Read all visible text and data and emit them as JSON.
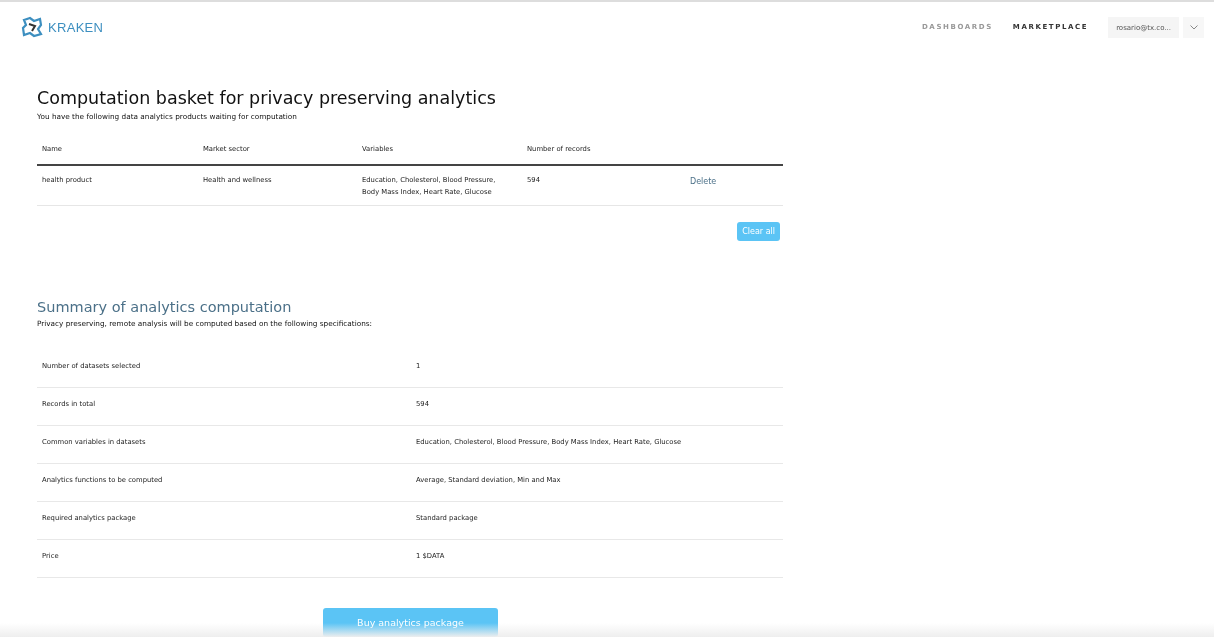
{
  "header": {
    "logo": "KRAKEN",
    "nav": [
      {
        "label": "DASHBOARDS",
        "selected": false
      },
      {
        "label": "MARKETPLACE",
        "selected": true
      }
    ],
    "user": "rosario@tx.co..."
  },
  "basket": {
    "title": "Computation basket for privacy preserving analytics",
    "subtitle": "You have the following data analytics products waiting for computation",
    "columns": [
      "Name",
      "Market sector",
      "Variables",
      "Number of records"
    ],
    "rows": [
      {
        "name": "health product",
        "sector": "Health and wellness",
        "variables": "Education, Cholesterol, Blood Pressure, Body Mass Index, Heart Rate, Glucose",
        "records": "594",
        "action": "Delete"
      }
    ],
    "clear_button": "Clear all"
  },
  "summary": {
    "title": "Summary of analytics computation",
    "subtitle": "Privacy preserving, remote analysis will be computed based on the following specifications:",
    "rows": [
      {
        "label": "Number of datasets selected",
        "value": "1"
      },
      {
        "label": "Records in total",
        "value": "594"
      },
      {
        "label": "Common variables in datasets",
        "value": "Education, Cholesterol, Blood Pressure, Body Mass Index, Heart Rate, Glucose"
      },
      {
        "label": "Analytics functions to be computed",
        "value": "Average, Standard deviation, Min and Max"
      },
      {
        "label": "Required analytics package",
        "value": "Standard package"
      },
      {
        "label": "Price",
        "value": "1 $DATA"
      }
    ],
    "buy_button": "Buy analytics package"
  }
}
